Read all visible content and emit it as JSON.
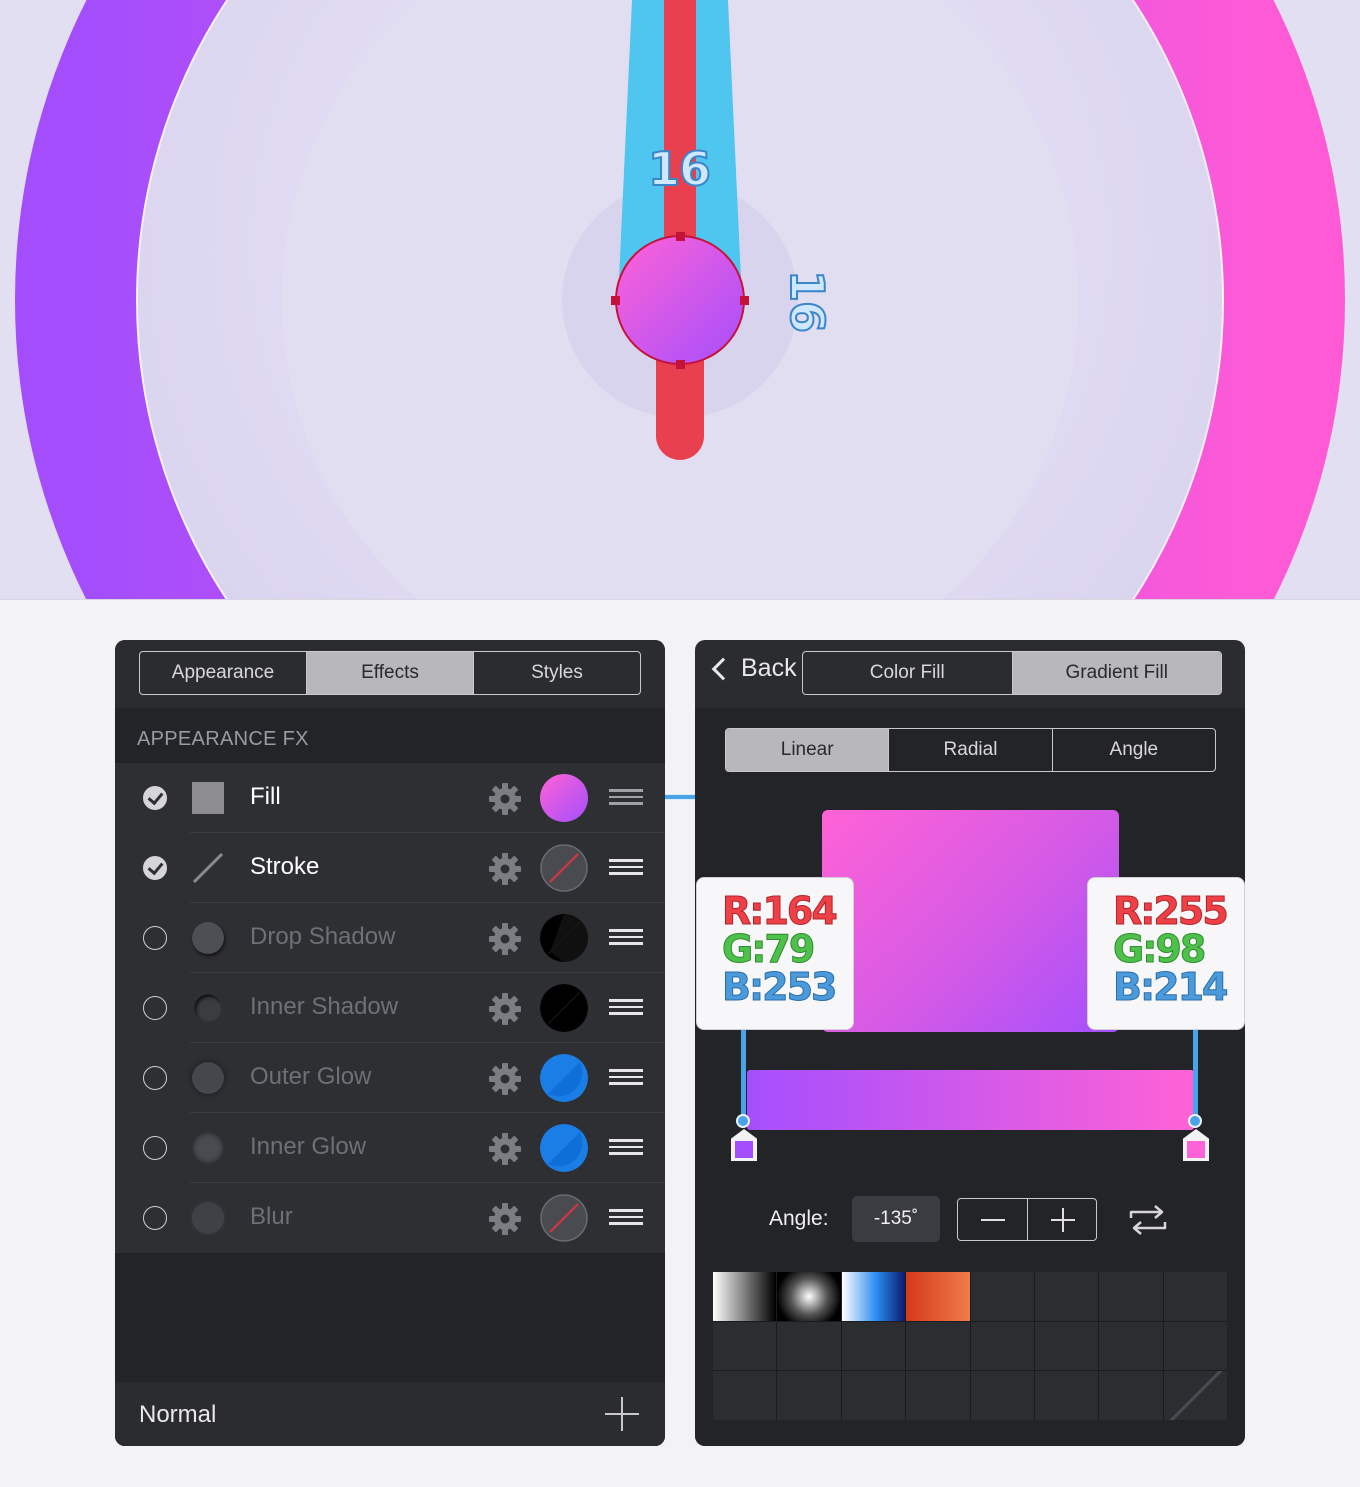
{
  "canvas": {
    "dimension_top": "16",
    "dimension_side": "16",
    "colors": {
      "ring_left": "#a34dfd",
      "ring_right": "#ff5ad6",
      "blue_bar": "#4ec6ef",
      "red_bar": "#e8404f",
      "knob_top": "#ff62d6",
      "knob_bottom": "#a44ffd"
    }
  },
  "left_panel": {
    "tabs": [
      "Appearance",
      "Effects",
      "Styles"
    ],
    "active_tab": 1,
    "section_title": "APPEARANCE FX",
    "effects": [
      {
        "label": "Fill",
        "enabled": true,
        "icon": "square-icon",
        "swatch": "gradient"
      },
      {
        "label": "Stroke",
        "enabled": true,
        "icon": "line-icon",
        "swatch": "none"
      },
      {
        "label": "Drop Shadow",
        "enabled": false,
        "icon": "circle-icon",
        "swatch": "black"
      },
      {
        "label": "Inner Shadow",
        "enabled": false,
        "icon": "circle-icon",
        "swatch": "black"
      },
      {
        "label": "Outer Glow",
        "enabled": false,
        "icon": "circle-icon",
        "swatch": "blue"
      },
      {
        "label": "Inner Glow",
        "enabled": false,
        "icon": "circle-icon",
        "swatch": "blue"
      },
      {
        "label": "Blur",
        "enabled": false,
        "icon": "circle-icon",
        "swatch": "none"
      }
    ],
    "blend_mode": "Normal"
  },
  "right_panel": {
    "back_label": "Back",
    "fill_tabs": [
      "Color Fill",
      "Gradient Fill"
    ],
    "active_fill_tab": 1,
    "gradient_types": [
      "Linear",
      "Radial",
      "Angle"
    ],
    "active_gradient_type": 0,
    "stop_left": {
      "r": "R:164",
      "g": "G:79",
      "b": "B:253",
      "color": "#a44ffd"
    },
    "stop_right": {
      "r": "R:255",
      "g": "G:98",
      "b": "B:214",
      "color": "#ff62d6"
    },
    "angle_label": "Angle:",
    "angle_value": "-135˚"
  }
}
